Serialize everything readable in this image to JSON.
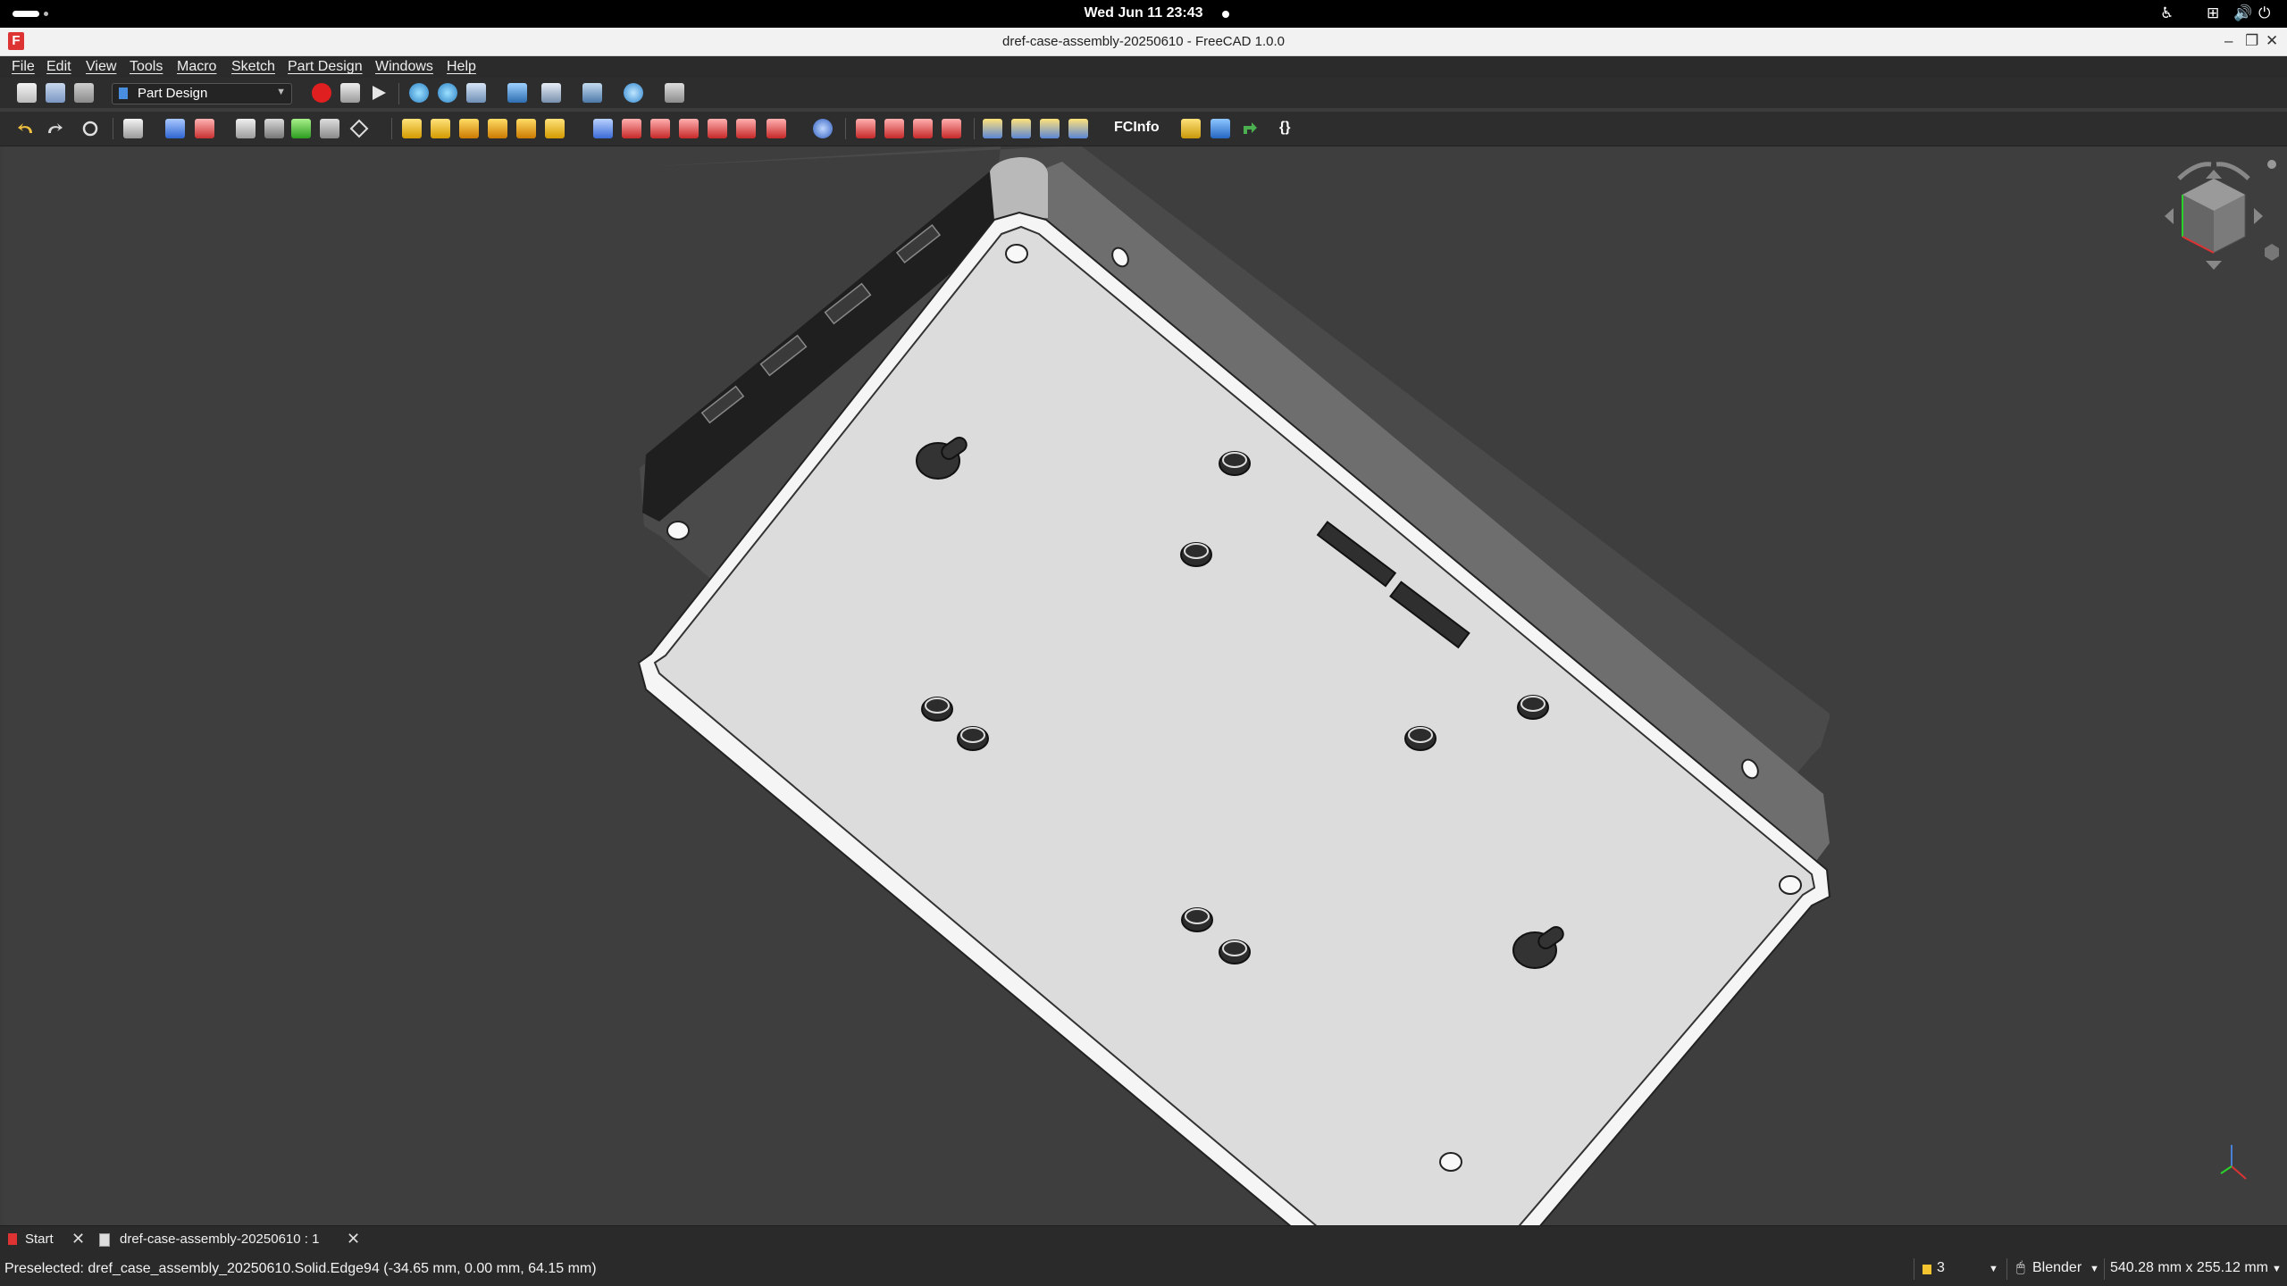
{
  "system": {
    "clock": "Wed Jun 11  23:43",
    "icons": [
      "accessibility-icon",
      "network-icon",
      "volume-icon",
      "power-icon"
    ]
  },
  "window": {
    "title": "dref-case-assembly-20250610 - FreeCAD 1.0.0",
    "controls": [
      "minimize-icon",
      "restore-icon",
      "close-icon"
    ]
  },
  "menubar": {
    "items": [
      "File",
      "Edit",
      "View",
      "Tools",
      "Macro",
      "Sketch",
      "Part Design",
      "Windows",
      "Help"
    ]
  },
  "toolbar": {
    "workbench": "Part Design",
    "fcinfo_label": "FCInfo",
    "braces_label": "{}",
    "record_color": "#e02020"
  },
  "tabs": [
    {
      "label": "Start"
    },
    {
      "label": "dref-case-assembly-20250610 : 1"
    }
  ],
  "statusbar": {
    "message": "Preselected: dref_case_assembly_20250610.Solid.Edge94 (-34.65 mm, 0.00 mm, 64.15 mm)",
    "notifications_count": "3",
    "navigation_style": "Blender",
    "dimensions": "540.28 mm x 255.12 mm"
  },
  "colors": {
    "viewport_bg": "#3e3e3e",
    "model_face": "#dcdcdc",
    "model_side": "#6e6e6e"
  }
}
